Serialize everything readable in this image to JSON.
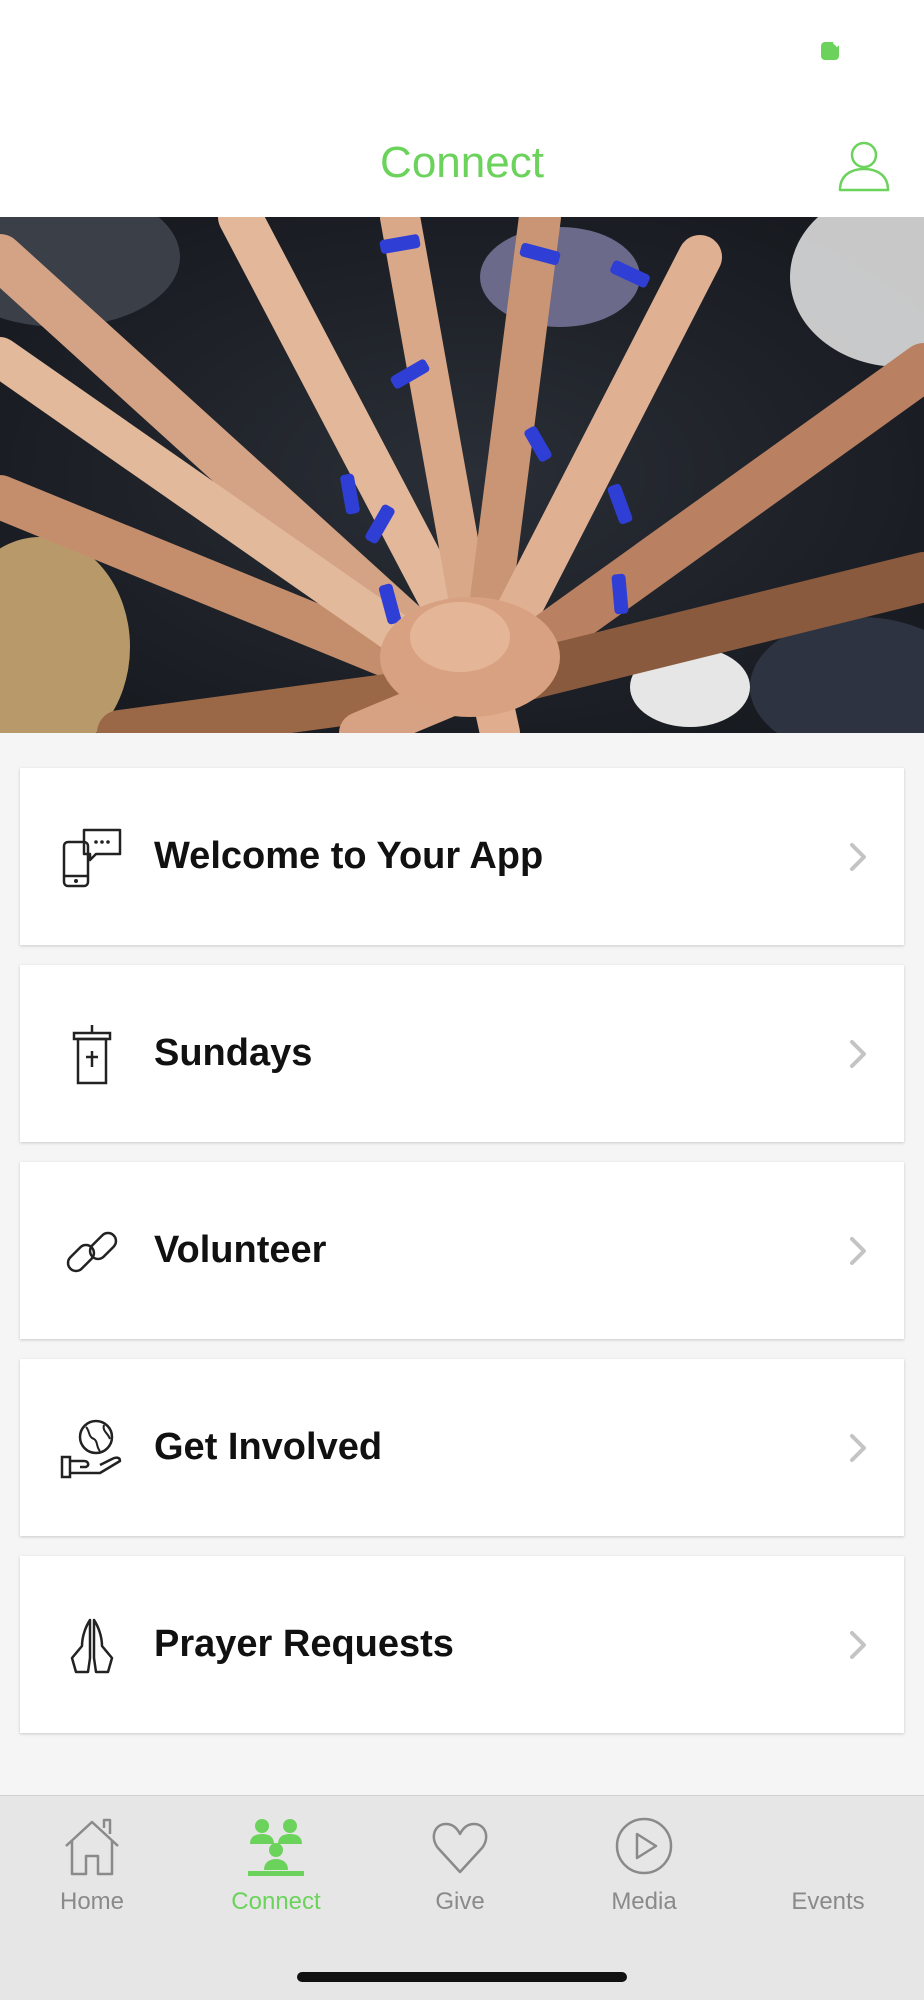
{
  "header": {
    "title": "Connect",
    "profile_icon": "user-icon"
  },
  "hero": {
    "image": "hands-together-photo"
  },
  "list": [
    {
      "label": "Welcome to Your App",
      "icon": "phone-chat-icon"
    },
    {
      "label": "Sundays",
      "icon": "pulpit-icon"
    },
    {
      "label": "Volunteer",
      "icon": "link-icon"
    },
    {
      "label": "Get Involved",
      "icon": "globe-hand-icon"
    },
    {
      "label": "Prayer Requests",
      "icon": "praying-hands-icon"
    }
  ],
  "tabbar": {
    "items": [
      {
        "label": "Home",
        "icon": "home-icon",
        "active": false
      },
      {
        "label": "Connect",
        "icon": "people-icon",
        "active": true
      },
      {
        "label": "Give",
        "icon": "heart-icon",
        "active": false
      },
      {
        "label": "Media",
        "icon": "play-icon",
        "active": false
      },
      {
        "label": "Events",
        "icon": "",
        "active": false
      }
    ]
  },
  "colors": {
    "accent": "#6bd35b",
    "tab_inactive": "#8a8a8a",
    "tabbar_bg": "#e6e6e6",
    "list_bg": "#f5f5f5"
  }
}
